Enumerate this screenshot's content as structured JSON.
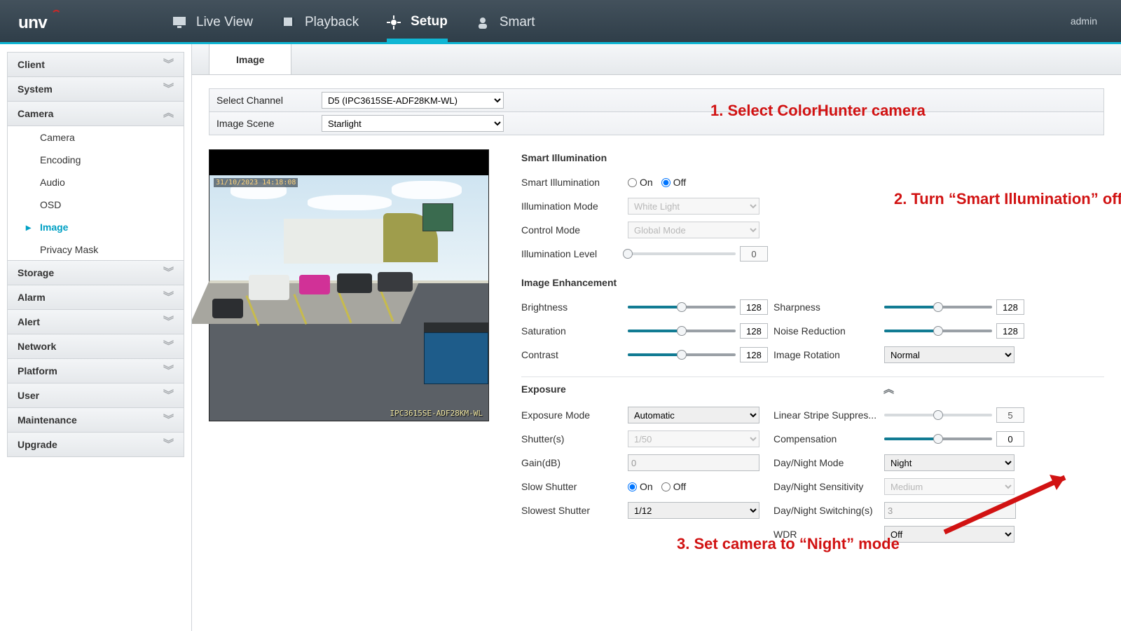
{
  "topbar": {
    "user": "admin",
    "items": [
      {
        "label": "Live View"
      },
      {
        "label": "Playback"
      },
      {
        "label": "Setup",
        "active": true
      },
      {
        "label": "Smart"
      }
    ]
  },
  "sidebar": [
    {
      "label": "Client",
      "open": false
    },
    {
      "label": "System",
      "open": false
    },
    {
      "label": "Camera",
      "open": true,
      "items": [
        {
          "label": "Camera"
        },
        {
          "label": "Encoding"
        },
        {
          "label": "Audio"
        },
        {
          "label": "OSD"
        },
        {
          "label": "Image",
          "active": true
        },
        {
          "label": "Privacy Mask"
        }
      ]
    },
    {
      "label": "Storage",
      "open": false
    },
    {
      "label": "Alarm",
      "open": false
    },
    {
      "label": "Alert",
      "open": false
    },
    {
      "label": "Network",
      "open": false
    },
    {
      "label": "Platform",
      "open": false
    },
    {
      "label": "User",
      "open": false
    },
    {
      "label": "Maintenance",
      "open": false
    },
    {
      "label": "Upgrade",
      "open": false
    }
  ],
  "tab": {
    "title": "Image"
  },
  "selector": {
    "channel_label": "Select Channel",
    "channel_value": "D5 (IPC3615SE-ADF28KM-WL)",
    "scene_label": "Image Scene",
    "scene_value": "Starlight"
  },
  "preview": {
    "timestamp": "31/10/2023 14:18:08",
    "model_overlay": "IPC3615SE-ADF28KM-WL"
  },
  "smart_illum": {
    "heading": "Smart Illumination",
    "toggle_label": "Smart Illumination",
    "on": "On",
    "off": "Off",
    "value": "Off",
    "mode_label": "Illumination Mode",
    "mode_value": "White Light",
    "control_label": "Control Mode",
    "control_value": "Global Mode",
    "level_label": "Illumination Level",
    "level_value": "0"
  },
  "enhance": {
    "heading": "Image Enhancement",
    "brightness": {
      "label": "Brightness",
      "value": "128"
    },
    "saturation": {
      "label": "Saturation",
      "value": "128"
    },
    "contrast": {
      "label": "Contrast",
      "value": "128"
    },
    "sharpness": {
      "label": "Sharpness",
      "value": "128"
    },
    "noise": {
      "label": "Noise Reduction",
      "value": "128"
    },
    "rotation": {
      "label": "Image Rotation",
      "value": "Normal"
    }
  },
  "exposure": {
    "heading": "Exposure",
    "mode": {
      "label": "Exposure Mode",
      "value": "Automatic"
    },
    "shutter": {
      "label": "Shutter(s)",
      "value": "1/50"
    },
    "gain": {
      "label": "Gain(dB)",
      "value": "0"
    },
    "slow": {
      "label": "Slow Shutter",
      "on": "On",
      "off": "Off",
      "value": "On"
    },
    "slowest": {
      "label": "Slowest Shutter",
      "value": "1/12"
    },
    "lss": {
      "label": "Linear Stripe Suppres...",
      "value": "5"
    },
    "comp": {
      "label": "Compensation",
      "value": "0"
    },
    "dnmode": {
      "label": "Day/Night Mode",
      "value": "Night"
    },
    "dnsens": {
      "label": "Day/Night Sensitivity",
      "value": "Medium"
    },
    "dnswitch": {
      "label": "Day/Night Switching(s)",
      "value": "3"
    },
    "wdr": {
      "label": "WDR",
      "value": "Off"
    }
  },
  "annotations": {
    "a1": "1. Select ColorHunter camera",
    "a2": "2. Turn “Smart Illumination” off",
    "a3": "3. Set camera to “Night” mode"
  }
}
